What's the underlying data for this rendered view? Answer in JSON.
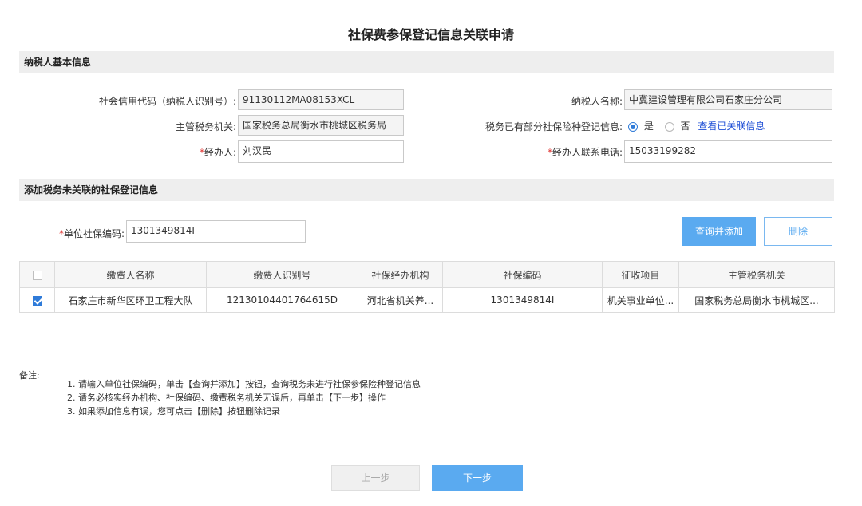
{
  "page_title": "社保费参保登记信息关联申请",
  "section1": {
    "title": "纳税人基本信息",
    "credit_code_label": "社会信用代码（纳税人识别号）:",
    "credit_code_value": "91130112MA08153XCL",
    "taxpayer_name_label": "纳税人名称:",
    "taxpayer_name_value": "中冀建设管理有限公司石家庄分公司",
    "tax_authority_label": "主管税务机关:",
    "tax_authority_value": "国家税务总局衡水市桃城区税务局",
    "registered_label": "税务已有部分社保险种登记信息:",
    "radio_yes": "是",
    "radio_no": "否",
    "view_link": "查看已关联信息",
    "agent_label": "经办人:",
    "agent_value": "刘汉民",
    "agent_phone_label": "经办人联系电话:",
    "agent_phone_value": "15033199282",
    "required_mark": "*"
  },
  "section2": {
    "title": "添加税务未关联的社保登记信息",
    "unit_code_label": "单位社保编码:",
    "unit_code_value": "1301349814I",
    "btn_query_add": "查询并添加",
    "btn_delete": "删除"
  },
  "table": {
    "headers": [
      "缴费人名称",
      "缴费人识别号",
      "社保经办机构",
      "社保编码",
      "征收项目",
      "主管税务机关"
    ],
    "rows": [
      [
        "石家庄市新华区环卫工程大队",
        "12130104401764615D",
        "河北省机关养...",
        "1301349814I",
        "机关事业单位...",
        "国家税务总局衡水市桃城区..."
      ]
    ]
  },
  "notes": {
    "label": "备注:",
    "items": [
      "1. 请输入单位社保编码，单击【查询并添加】按钮，查询税务未进行社保参保险种登记信息",
      "2. 请务必核实经办机构、社保编码、缴费税务机关无误后，再单击【下一步】操作",
      "3. 如果添加信息有误，您可点击【删除】按钮删除记录"
    ]
  },
  "footer": {
    "prev": "上一步",
    "next": "下一步"
  }
}
